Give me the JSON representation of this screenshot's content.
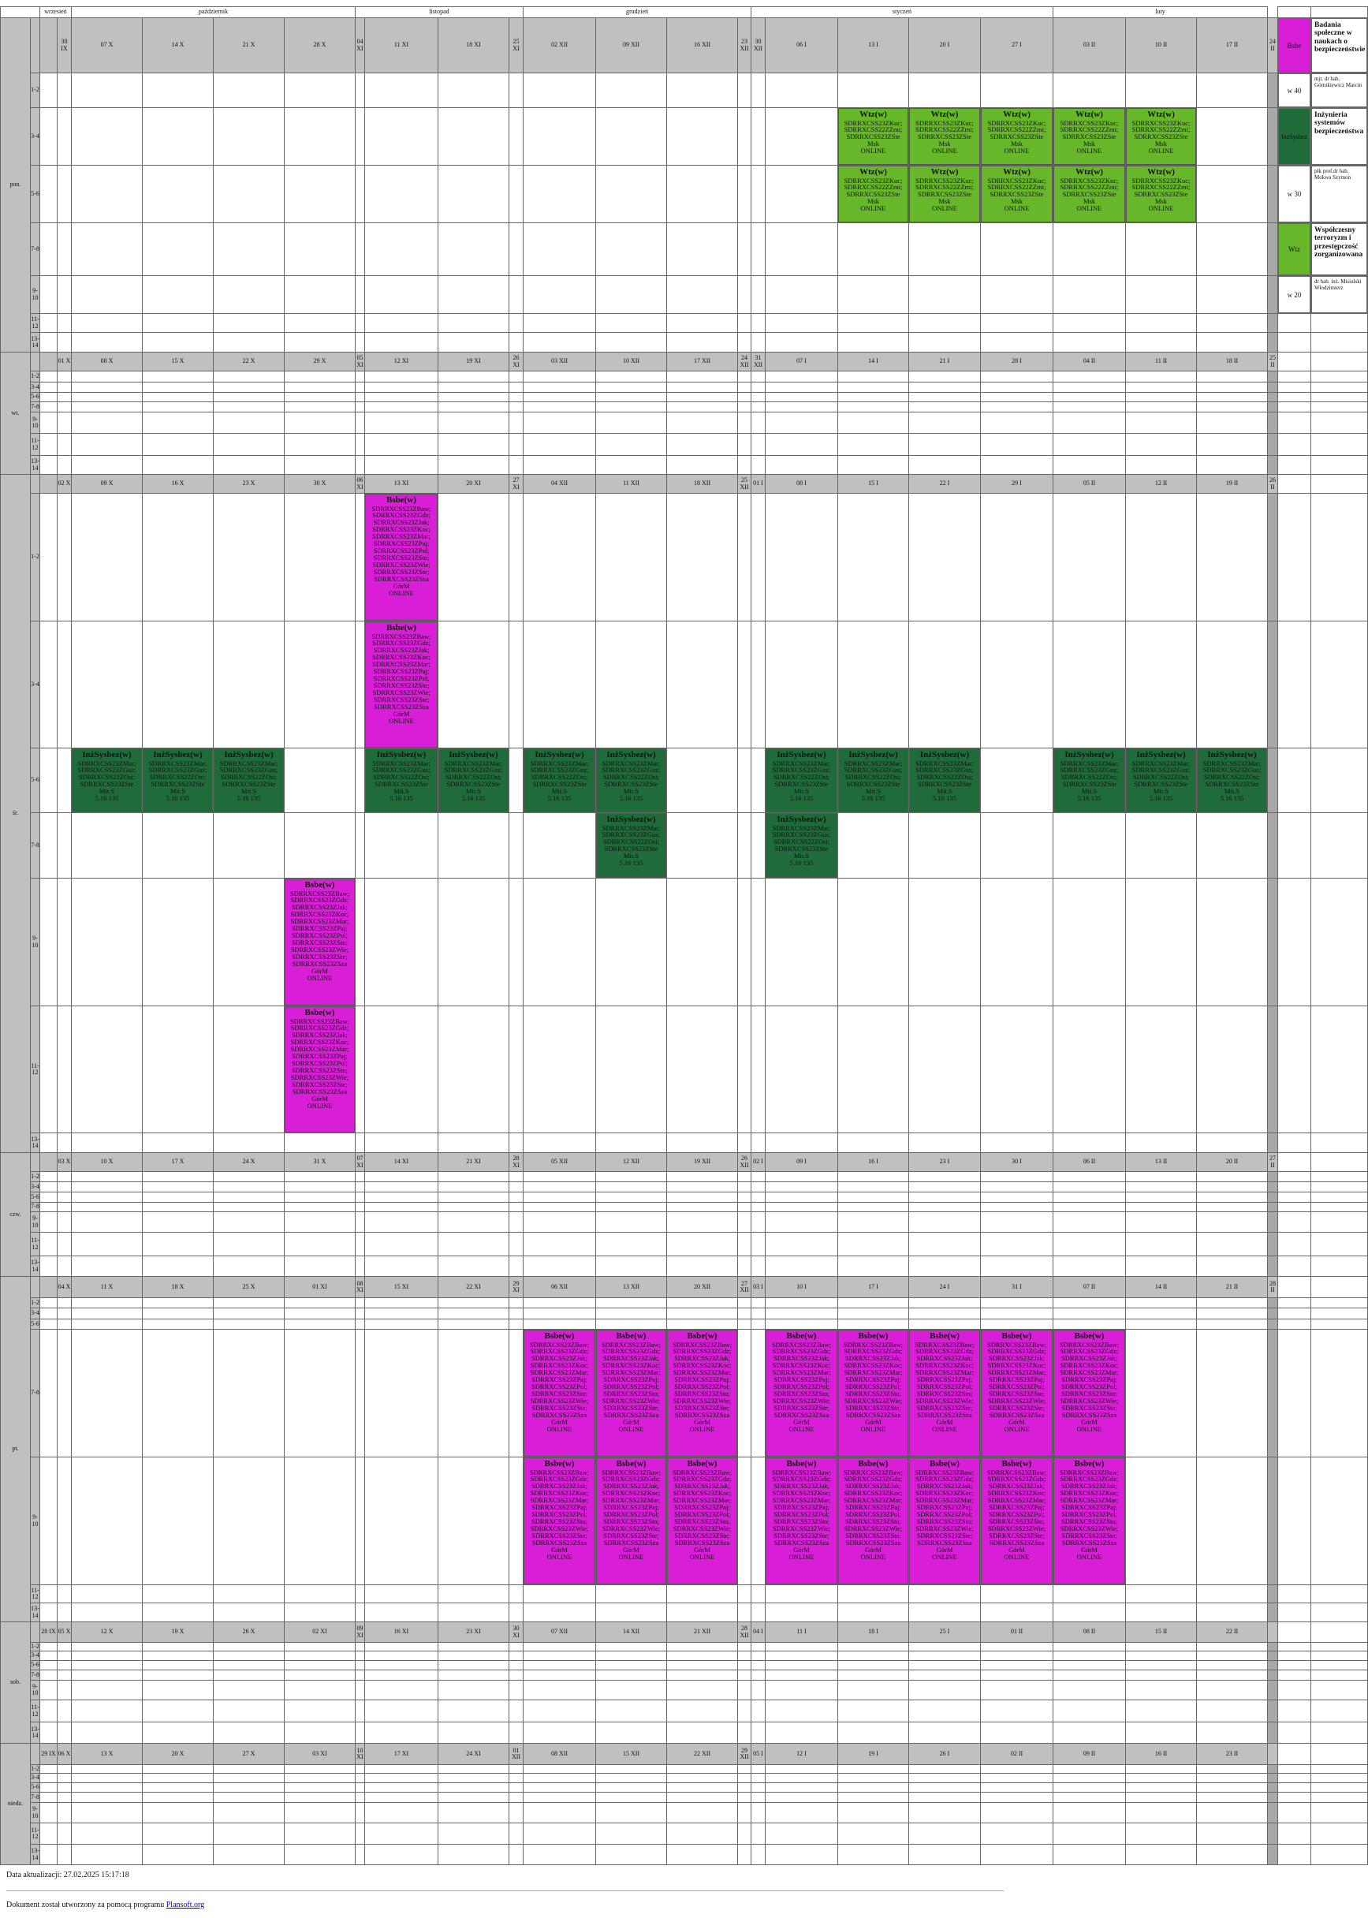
{
  "months": [
    {
      "label": "wrzesień"
    },
    {
      "label": "październik"
    },
    {
      "label": "listopad"
    },
    {
      "label": "grudzień"
    },
    {
      "label": "styczeń"
    },
    {
      "label": "luty"
    }
  ],
  "day_names": [
    "pon.",
    "wt.",
    "śr.",
    "czw.",
    "pt.",
    "sob.",
    "niedz."
  ],
  "slot_labels": [
    "1-2",
    "3-4",
    "5-6",
    "7-8",
    "9-10",
    "11-12",
    "13-14"
  ],
  "day_dates": [
    [
      "",
      "30 IX",
      "07 X",
      "14 X",
      "21 X",
      "28 X",
      "04 XI",
      "11 XI",
      "18 XI",
      "25 XI",
      "02 XII",
      "09 XII",
      "16 XII",
      "23 XII",
      "30 XII",
      "06 I",
      "13 I",
      "20 I",
      "27 I",
      "03 II",
      "10 II",
      "17 II",
      "24 II"
    ],
    [
      "",
      "01 X",
      "08 X",
      "15 X",
      "22 X",
      "29 X",
      "05 XI",
      "12 XI",
      "19 XI",
      "26 XI",
      "03 XII",
      "10 XII",
      "17 XII",
      "24 XII",
      "31 XII",
      "07 I",
      "14 I",
      "21 I",
      "28 I",
      "04 II",
      "11 II",
      "18 II",
      "25 II"
    ],
    [
      "",
      "02 X",
      "09 X",
      "16 X",
      "23 X",
      "30 X",
      "06 XI",
      "13 XI",
      "20 XI",
      "27 XI",
      "04 XII",
      "11 XII",
      "18 XII",
      "25 XII",
      "01 I",
      "08 I",
      "15 I",
      "22 I",
      "29 I",
      "05 II",
      "12 II",
      "19 II",
      "26 II"
    ],
    [
      "",
      "03 X",
      "10 X",
      "17 X",
      "24 X",
      "31 X",
      "07 XI",
      "14 XI",
      "21 XI",
      "28 XI",
      "05 XII",
      "12 XII",
      "19 XII",
      "26 XII",
      "02 I",
      "09 I",
      "16 I",
      "23 I",
      "30 I",
      "06 II",
      "13 II",
      "20 II",
      "27 II"
    ],
    [
      "",
      "04 X",
      "11 X",
      "18 X",
      "25 X",
      "01 XI",
      "08 XI",
      "15 XI",
      "22 XI",
      "29 XI",
      "06 XII",
      "13 XII",
      "20 XII",
      "27 XII",
      "03 I",
      "10 I",
      "17 I",
      "24 I",
      "31 I",
      "07 II",
      "14 II",
      "21 II",
      "28 II"
    ],
    [
      "28 IX",
      "05 X",
      "12 X",
      "19 X",
      "26 X",
      "02 XI",
      "09 XI",
      "16 XI",
      "23 XI",
      "30 XI",
      "07 XII",
      "14 XII",
      "21 XII",
      "28 XII",
      "04 I",
      "11 I",
      "18 I",
      "25 I",
      "01 II",
      "08 II",
      "15 II",
      "22 II",
      ""
    ],
    [
      "29 IX",
      "06 X",
      "13 X",
      "20 X",
      "27 X",
      "03 XI",
      "10 XI",
      "17 XI",
      "24 XI",
      "01 XII",
      "08 XII",
      "15 XII",
      "22 XII",
      "29 XII",
      "05 I",
      "12 I",
      "19 I",
      "26 I",
      "02 II",
      "09 II",
      "16 II",
      "23 II",
      ""
    ]
  ],
  "courses": {
    "wtz": {
      "title": "Wtz(w)",
      "color": "#66b82a",
      "text_color": "#111",
      "lines": [
        "SDRRXCSS23ZKuc;",
        "SDRRXCSS22ZZmi;",
        "SDRRXCSS23ZSte",
        "Msk",
        "ONLINE"
      ]
    },
    "inz": {
      "title": "InżSysbez(w)",
      "color": "#1f6b3a",
      "text_color": "#111",
      "lines": [
        "SDRRXCSS23ZMar;",
        "SDRRXCSS23ZGuz;",
        "SDRRXCSS22ZOsi;",
        "SDRRXCSS23ZSte",
        "Mit.S",
        "5.16 135"
      ]
    },
    "bsbe": {
      "title": "Bsbe(w)",
      "color": "#d81ed6",
      "text_color": "#111",
      "lines": [
        "SDRRXCSS23ZBaw;",
        "SDRRXCSS23ZGdz;",
        "SDRRXCSS23ZJak;",
        "SDRRXCSS23ZKoc;",
        "SDRRXCSS23ZMar;",
        "SDRRXCSS23ZPaj;",
        "SDRRXCSS23ZPol;",
        "SDRRXCSS23ZSto;",
        "SDRRXCSS23ZWie;",
        "SDRRXCSS23ZSte;",
        "SDRRXCSS23ZSza",
        "GórM",
        "ONLINE"
      ]
    }
  },
  "events": [
    {
      "course": "wtz",
      "day": 0,
      "slot": 1,
      "cols": [
        16,
        17,
        18,
        19,
        20
      ]
    },
    {
      "course": "wtz",
      "day": 0,
      "slot": 2,
      "cols": [
        16,
        17,
        18,
        19,
        20
      ]
    },
    {
      "course": "bsbe",
      "day": 2,
      "slot": 0,
      "cols": [
        7
      ]
    },
    {
      "course": "bsbe",
      "day": 2,
      "slot": 1,
      "cols": [
        7
      ]
    },
    {
      "course": "inz",
      "day": 2,
      "slot": 2,
      "cols": [
        2,
        3,
        4,
        7,
        8,
        10,
        11,
        15,
        16,
        17,
        19,
        20,
        21
      ]
    },
    {
      "course": "inz",
      "day": 2,
      "slot": 3,
      "cols": [
        11,
        15
      ]
    },
    {
      "course": "bsbe",
      "day": 2,
      "slot": 4,
      "cols": [
        5
      ]
    },
    {
      "course": "bsbe",
      "day": 2,
      "slot": 5,
      "cols": [
        5
      ]
    },
    {
      "course": "bsbe",
      "day": 4,
      "slot": 3,
      "cols": [
        10,
        11,
        12,
        15,
        16,
        17,
        18,
        19
      ]
    },
    {
      "course": "bsbe",
      "day": 4,
      "slot": 4,
      "cols": [
        10,
        11,
        12,
        15,
        16,
        17,
        18,
        19
      ]
    }
  ],
  "legend": [
    {
      "code": "Bsbe",
      "color": "#d81ed6",
      "name": "Badania społeczne w naukach o bezpieczeństwie",
      "hours": "w 40",
      "lecturer": "mjr. dr hab. Górnikiewicz Marcin"
    },
    {
      "code": "InżSysbez",
      "color": "#1f6b3a",
      "name": "Inżynieria systemów bezpieczeństwa",
      "hours": "w 30",
      "lecturer": "płk prof.dr hab. Mokwa Szymon"
    },
    {
      "code": "Wtz",
      "color": "#66b82a",
      "name": "Współczesny terroryzm i przestępczość zorganizowana",
      "hours": "w 20",
      "lecturer": "dr hab. inż. Misiulski Włodzimierz"
    }
  ],
  "footer": {
    "update": "Data aktualizacji: 27.02.2025 15:17:18",
    "created_prefix": "Dokument został utworzony za pomocą programu ",
    "created_link": "Plansoft.org"
  }
}
